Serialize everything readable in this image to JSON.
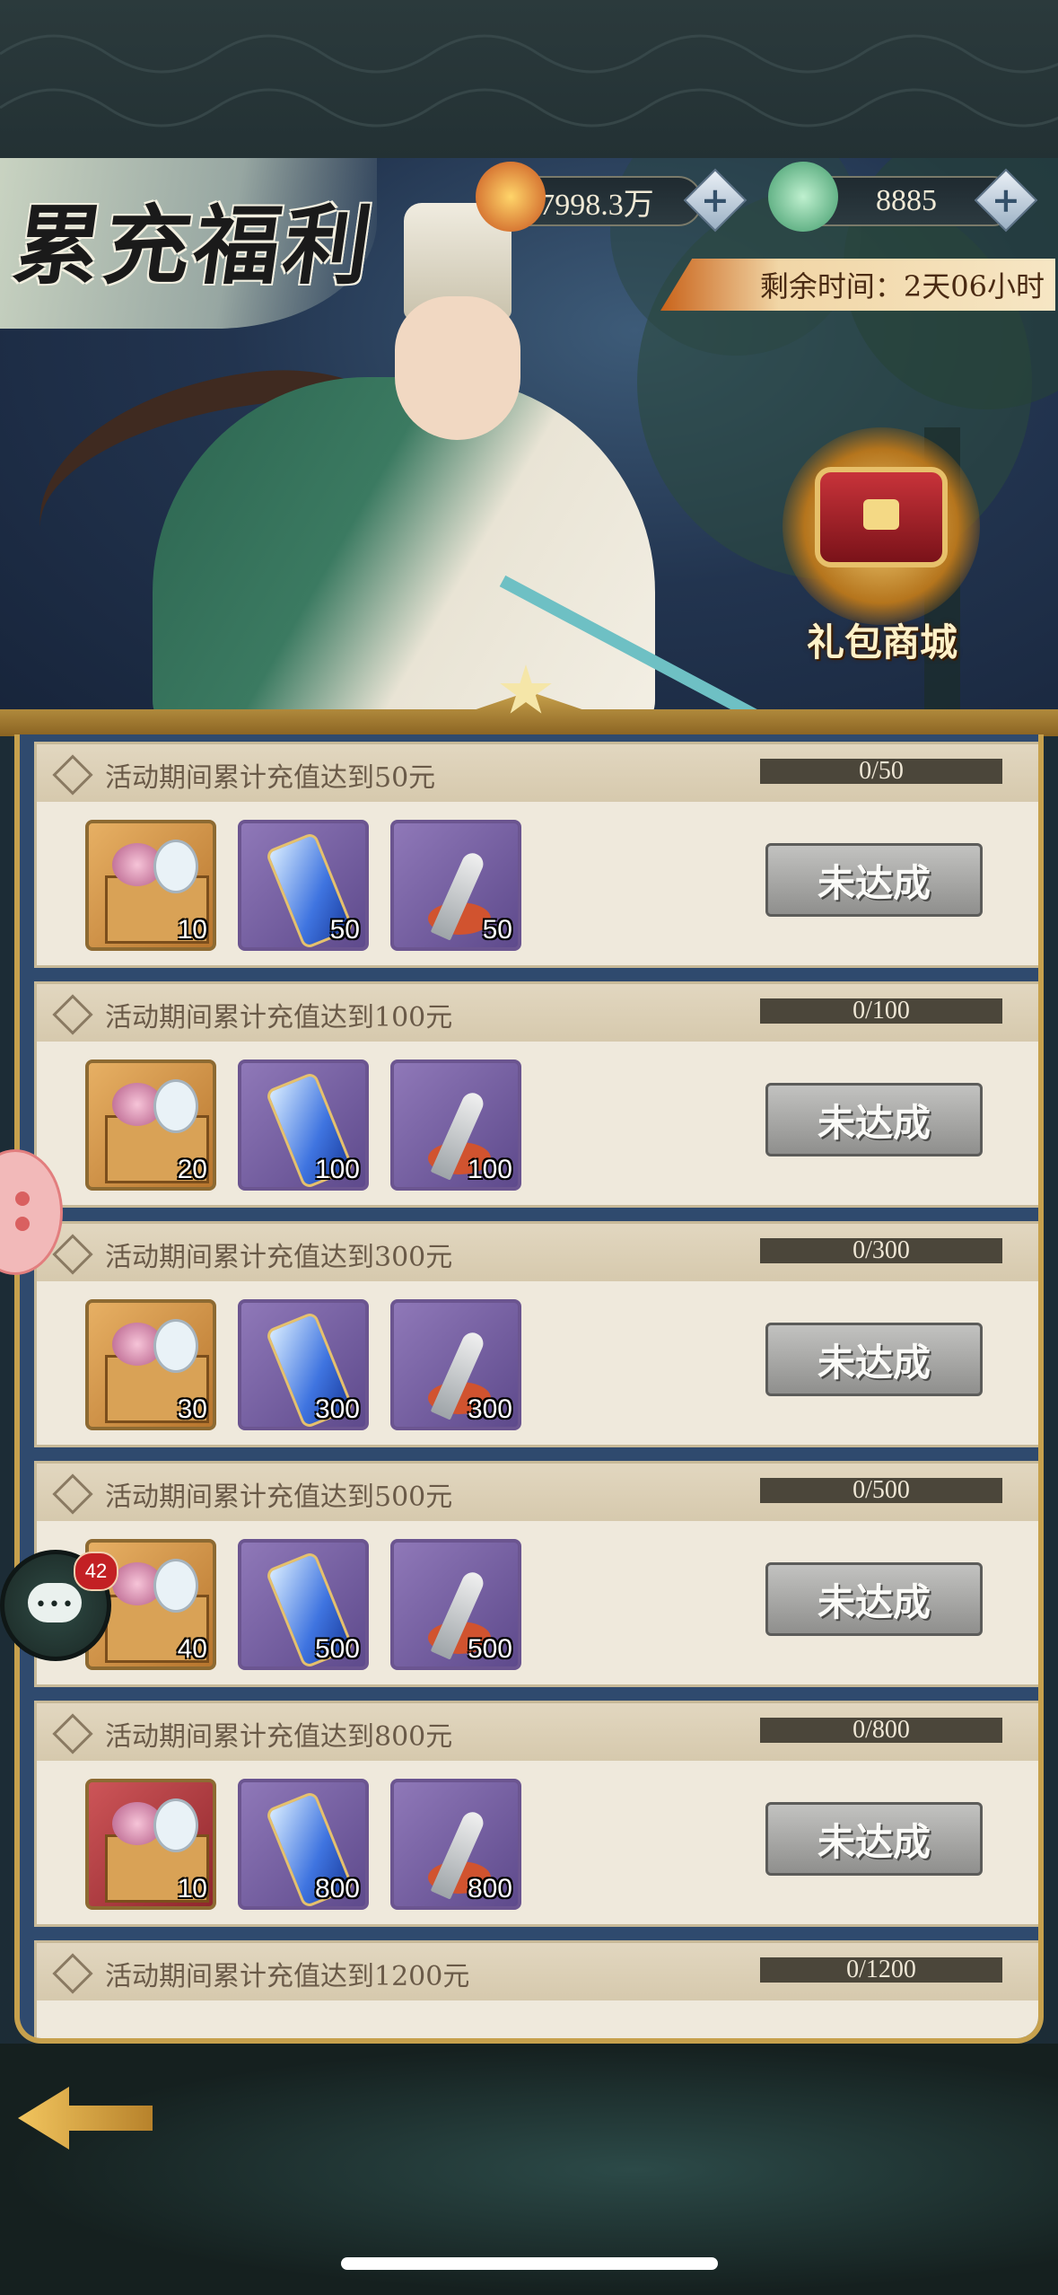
{
  "header": {
    "title": "累充福利",
    "gold_amount": "7998.3万",
    "jade_amount": "8885",
    "timer_label": "剩余时间：",
    "timer_value": "2天06小时"
  },
  "gift_shop": {
    "label": "礼包商城"
  },
  "rewards": [
    {
      "title": "活动期间累计充值达到50元",
      "progress": "0/50",
      "button": "未达成",
      "items": [
        {
          "type": "chest",
          "count": "10"
        },
        {
          "type": "gem",
          "count": "50"
        },
        {
          "type": "blade",
          "count": "50"
        }
      ]
    },
    {
      "title": "活动期间累计充值达到100元",
      "progress": "0/100",
      "button": "未达成",
      "items": [
        {
          "type": "chest",
          "count": "20"
        },
        {
          "type": "gem",
          "count": "100"
        },
        {
          "type": "blade",
          "count": "100"
        }
      ]
    },
    {
      "title": "活动期间累计充值达到300元",
      "progress": "0/300",
      "button": "未达成",
      "items": [
        {
          "type": "chest",
          "count": "30"
        },
        {
          "type": "gem",
          "count": "300"
        },
        {
          "type": "blade",
          "count": "300"
        }
      ]
    },
    {
      "title": "活动期间累计充值达到500元",
      "progress": "0/500",
      "button": "未达成",
      "items": [
        {
          "type": "chest",
          "count": "40"
        },
        {
          "type": "gem",
          "count": "500"
        },
        {
          "type": "blade",
          "count": "500"
        }
      ]
    },
    {
      "title": "活动期间累计充值达到800元",
      "progress": "0/800",
      "button": "未达成",
      "items": [
        {
          "type": "red-chest",
          "count": "10"
        },
        {
          "type": "gem",
          "count": "800"
        },
        {
          "type": "blade",
          "count": "800"
        }
      ]
    },
    {
      "title": "活动期间累计充值达到1200元",
      "progress": "0/1200",
      "button": "",
      "items": []
    }
  ],
  "chat": {
    "badge": "42"
  },
  "colors": {
    "panel_border": "#c7a14d",
    "button_gray": "#8f8f8d",
    "progress_bg": "#4b463a"
  }
}
